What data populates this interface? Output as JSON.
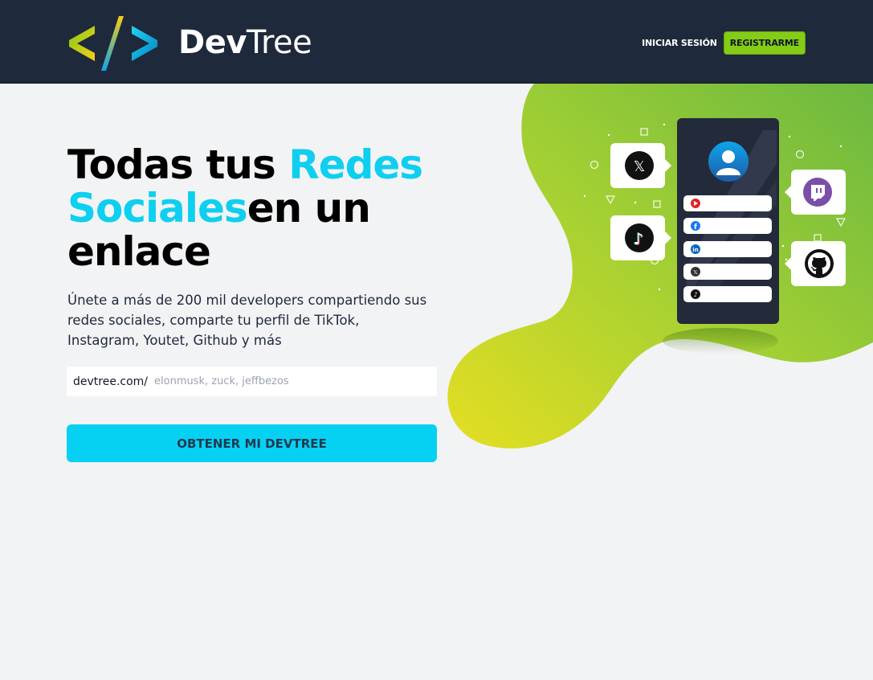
{
  "header": {
    "logo_part1": "Dev",
    "logo_part2": "Tree",
    "logo_icon": "code-brackets-icon",
    "nav": {
      "login_label": "INICIAR SESIÓN",
      "register_label": "REGISTRARME"
    }
  },
  "hero": {
    "title_part1": "Todas tus ",
    "title_accent": "Redes Sociales",
    "title_part2": "en un enlace",
    "description": "Únete a más de 200 mil developers compartiendo sus redes sociales, comparte tu perfil de TikTok, Instagram, Youtet, Github y más",
    "slug_prefix": "devtree.com/",
    "slug_placeholder": "elonmusk, zuck, jeffbezos",
    "cta_label": "OBTENER MI DEVTREE"
  },
  "illustration": {
    "bubbles": [
      "x-icon",
      "tiktok-icon",
      "twitch-icon",
      "github-icon"
    ],
    "phone_links": [
      "youtube-icon",
      "facebook-icon",
      "linkedin-icon",
      "x-icon",
      "tiktok-icon"
    ]
  },
  "colors": {
    "header_bg": "#1e293b",
    "accent_cyan": "#0ecfef",
    "brand_lime": "#84cc16",
    "page_bg": "#f2f3f5"
  }
}
